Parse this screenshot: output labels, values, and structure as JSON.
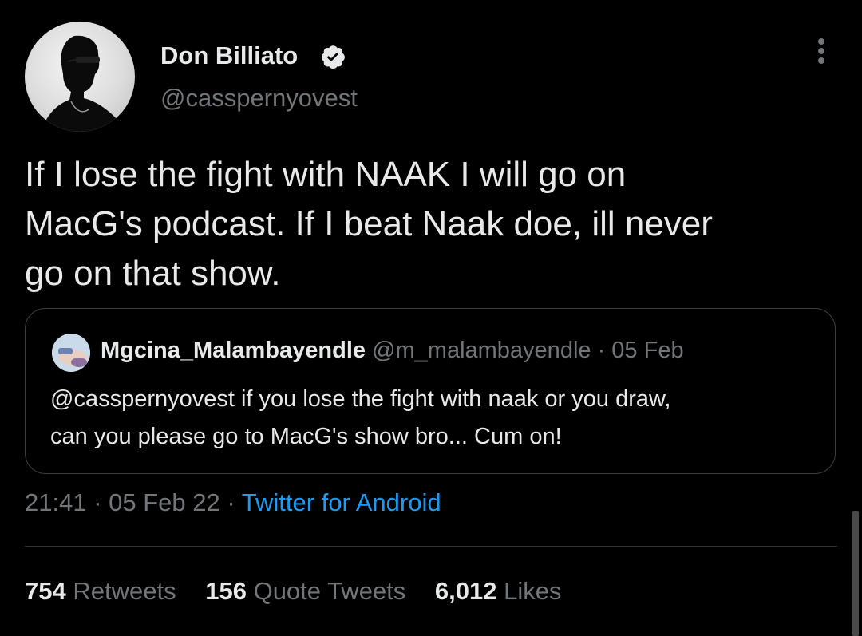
{
  "author": {
    "display_name": "Don Billiato",
    "handle": "@casspernyovest",
    "verified_icon": "verified-badge-icon"
  },
  "more_icon": "more-options-icon",
  "tweet": {
    "text": "If I lose the fight with NAAK  I will go on\nMacG's podcast. If I beat Naak doe, ill never\ngo on that show."
  },
  "quote": {
    "name": "Mgcina_Malambayendle",
    "handle": "@m_malambayendle",
    "separator": " · ",
    "date": "05 Feb",
    "text": "@casspernyovest if you lose the fight with naak or you draw,\ncan you please go to MacG's show bro... Cum on!"
  },
  "meta": {
    "time": "21:41",
    "sep1": " · ",
    "date": "05 Feb 22",
    "sep2": " · ",
    "source": "Twitter for Android"
  },
  "stats": {
    "retweets_count": "754",
    "retweets_label": "Retweets",
    "quotes_count": "156",
    "quotes_label": "Quote Tweets",
    "likes_count": "6,012",
    "likes_label": "Likes"
  },
  "colors": {
    "background": "#000000",
    "text": "#e7e9ea",
    "secondary": "#71767b",
    "link": "#1d9bf0",
    "border": "#3a3f44"
  }
}
